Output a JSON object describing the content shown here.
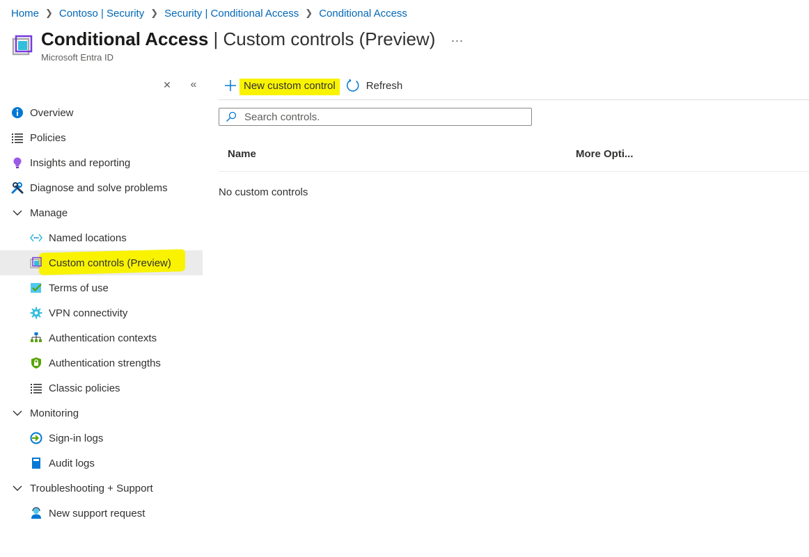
{
  "breadcrumb": [
    {
      "label": "Home"
    },
    {
      "label": "Contoso | Security"
    },
    {
      "label": "Security | Conditional Access"
    },
    {
      "label": "Conditional Access"
    }
  ],
  "header": {
    "title_bold": "Conditional Access",
    "title_rest": " | Custom controls (Preview)",
    "more_label": "...",
    "subtitle": "Microsoft Entra ID"
  },
  "sidebar": {
    "close_icon": "close-icon",
    "collapse_icon": "collapse-double-chevron-icon",
    "items": [
      {
        "label": "Overview",
        "icon": "info-icon"
      },
      {
        "label": "Policies",
        "icon": "list-icon"
      },
      {
        "label": "Insights and reporting",
        "icon": "lightbulb-icon"
      },
      {
        "label": "Diagnose and solve problems",
        "icon": "wrench-icon"
      },
      {
        "label": "Manage",
        "icon": "chevron-down-icon"
      },
      {
        "label": "Named locations",
        "icon": "named-locations-icon"
      },
      {
        "label": "Custom controls (Preview)",
        "icon": "custom-controls-icon",
        "selected": true
      },
      {
        "label": "Terms of use",
        "icon": "checklist-icon"
      },
      {
        "label": "VPN connectivity",
        "icon": "gear-icon"
      },
      {
        "label": "Authentication contexts",
        "icon": "hierarchy-icon"
      },
      {
        "label": "Authentication strengths",
        "icon": "shield-lock-icon"
      },
      {
        "label": "Classic policies",
        "icon": "list-icon"
      },
      {
        "label": "Monitoring",
        "icon": "chevron-down-icon"
      },
      {
        "label": "Sign-in logs",
        "icon": "sign-in-icon"
      },
      {
        "label": "Audit logs",
        "icon": "book-icon"
      },
      {
        "label": "Troubleshooting + Support",
        "icon": "chevron-down-icon"
      },
      {
        "label": "New support request",
        "icon": "support-person-icon"
      }
    ]
  },
  "toolbar": {
    "new_label": "New custom control",
    "refresh_label": "Refresh"
  },
  "search": {
    "placeholder": "Search controls."
  },
  "table": {
    "columns": [
      "Name",
      "More Opti..."
    ],
    "empty_text": "No custom controls"
  },
  "colors": {
    "link": "#0067b8",
    "highlight": "#f9f300",
    "selected_bg": "#ebebeb"
  }
}
